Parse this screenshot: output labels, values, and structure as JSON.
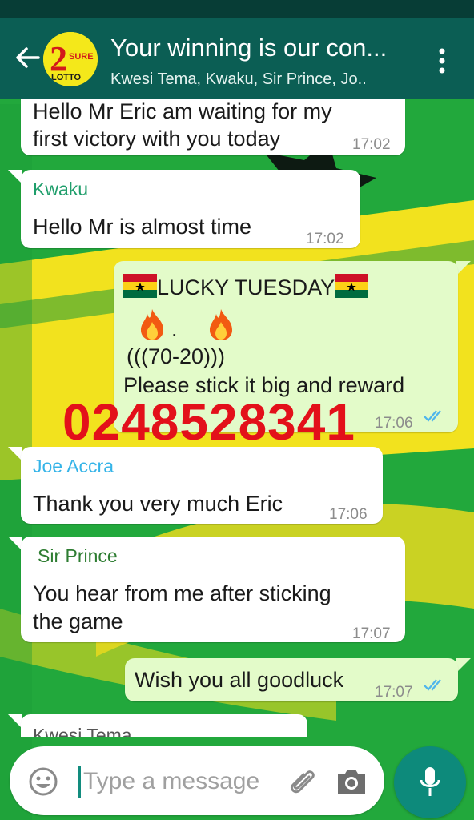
{
  "header": {
    "title": "Your winning is our con...",
    "subtitle": "Kwesi Tema, Kwaku,  Sir Prince, Jo..",
    "avatar_text_top": "SURE",
    "avatar_text_bottom": "LOTTO",
    "avatar_digit": "2",
    "icons": [
      "back-arrow-icon",
      "group-avatar",
      "more-vert-icon"
    ]
  },
  "messages": [
    {
      "direction": "in",
      "sender": "",
      "lines": [
        "Hello Mr Eric am waiting for my",
        "first victory with you today"
      ],
      "time": "17:02"
    },
    {
      "direction": "in",
      "sender": "Kwaku",
      "sender_color": "#1f9e6b",
      "lines": [
        "Hello Mr is almost time"
      ],
      "time": "17:02"
    },
    {
      "direction": "out",
      "lines": [
        "LUCKY TUESDAY",
        ".",
        "(((70-20)))",
        "Please stick it big and reward"
      ],
      "time": "17:06",
      "status": "read"
    },
    {
      "direction": "in",
      "sender": "Joe Accra",
      "sender_color": "#35b4e8",
      "lines": [
        "Thank you very much Eric"
      ],
      "time": "17:06"
    },
    {
      "direction": "in",
      "sender": "Sir Prince",
      "sender_color": "#2e7d32",
      "lines": [
        "You hear from me after sticking",
        "the game"
      ],
      "time": "17:07"
    },
    {
      "direction": "out",
      "lines": [
        "Wish you all goodluck"
      ],
      "time": "17:07",
      "status": "read"
    },
    {
      "direction": "in",
      "sender": "Kwesi Tema",
      "sender_color": "#555555",
      "lines": [],
      "time": ""
    }
  ],
  "watermark": "0248528341",
  "composer": {
    "placeholder": "Type a message",
    "icons": [
      "emoji-icon",
      "attach-icon",
      "camera-icon",
      "mic-icon"
    ]
  },
  "colors": {
    "header": "#0b5e54",
    "outgoing_bubble": "#e3fbc9",
    "incoming_bubble": "#ffffff",
    "read_ticks": "#4fb6ec",
    "mic_button": "#0d8a7b",
    "watermark": "#e3101a"
  }
}
